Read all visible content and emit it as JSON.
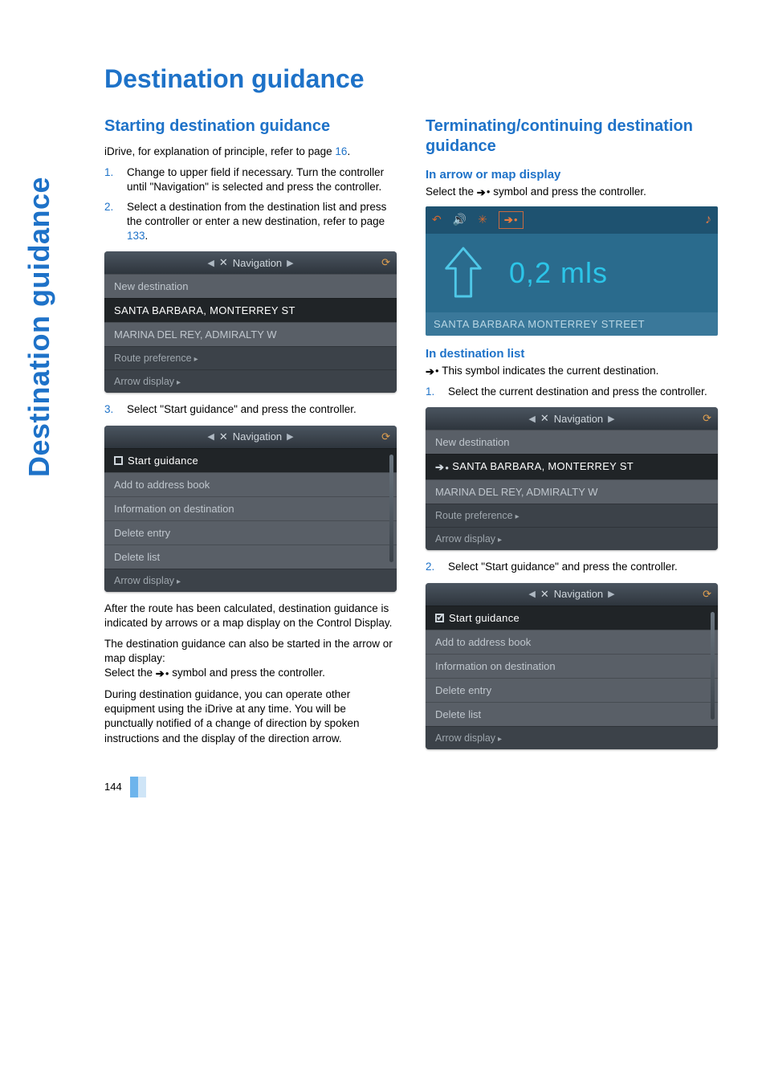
{
  "sideTab": "Destination guidance",
  "title": "Destination guidance",
  "pageNumber": "144",
  "left": {
    "h2": "Starting destination guidance",
    "intro_a": "iDrive, for explanation of principle, refer to page ",
    "intro_link": "16",
    "intro_b": ".",
    "step1": "Change to upper field if necessary. Turn the controller until \"Navigation\" is selected and press the controller.",
    "step2_a": "Select a destination from the destination list and press the controller or enter a new destination, refer to page ",
    "step2_link": "133",
    "step2_b": ".",
    "ss1": {
      "header": "Navigation",
      "r1": "New destination",
      "r2": "SANTA BARBARA, MONTERREY ST",
      "r3": "MARINA DEL REY, ADMIRALTY W",
      "r4": "Route preference",
      "r5": "Arrow display"
    },
    "step3": "Select \"Start guidance\" and press the controller.",
    "ss2": {
      "header": "Navigation",
      "r1": "Start guidance",
      "r2": "Add to address book",
      "r3": "Information on destination",
      "r4": "Delete entry",
      "r5": "Delete list",
      "r6": "Arrow display"
    },
    "para1": "After the route has been calculated, destination guidance is indicated by arrows or a map display on the Control Display.",
    "para2_a": "The destination guidance can also be started in the arrow or map display:",
    "para2_b_pre": "Select the ",
    "para2_b_post": " symbol and press the controller.",
    "para3": "During destination guidance, you can operate other equipment using the iDrive at any time. You will be punctually notified of a change of direction by spoken instructions and the display of the direction arrow."
  },
  "right": {
    "h2": "Terminating/continuing destination guidance",
    "sub1": "In arrow or map display",
    "p1_pre": "Select the ",
    "p1_post": " symbol and press the controller.",
    "map": {
      "distance": "0,2 mls",
      "street": "SANTA BARBARA MONTERREY STREET"
    },
    "sub2": "In destination list",
    "p2": " This symbol indicates the current destination.",
    "step1": "Select the current destination and press the controller.",
    "ss1": {
      "header": "Navigation",
      "r1": "New destination",
      "r2": "SANTA BARBARA, MONTERREY ST",
      "r3": "MARINA DEL REY, ADMIRALTY W",
      "r4": "Route preference",
      "r5": "Arrow display"
    },
    "step2": "Select \"Start guidance\" and press the controller.",
    "ss2": {
      "header": "Navigation",
      "r1": "Start guidance",
      "r2": "Add to address book",
      "r3": "Information on destination",
      "r4": "Delete entry",
      "r5": "Delete list",
      "r6": "Arrow display"
    }
  }
}
